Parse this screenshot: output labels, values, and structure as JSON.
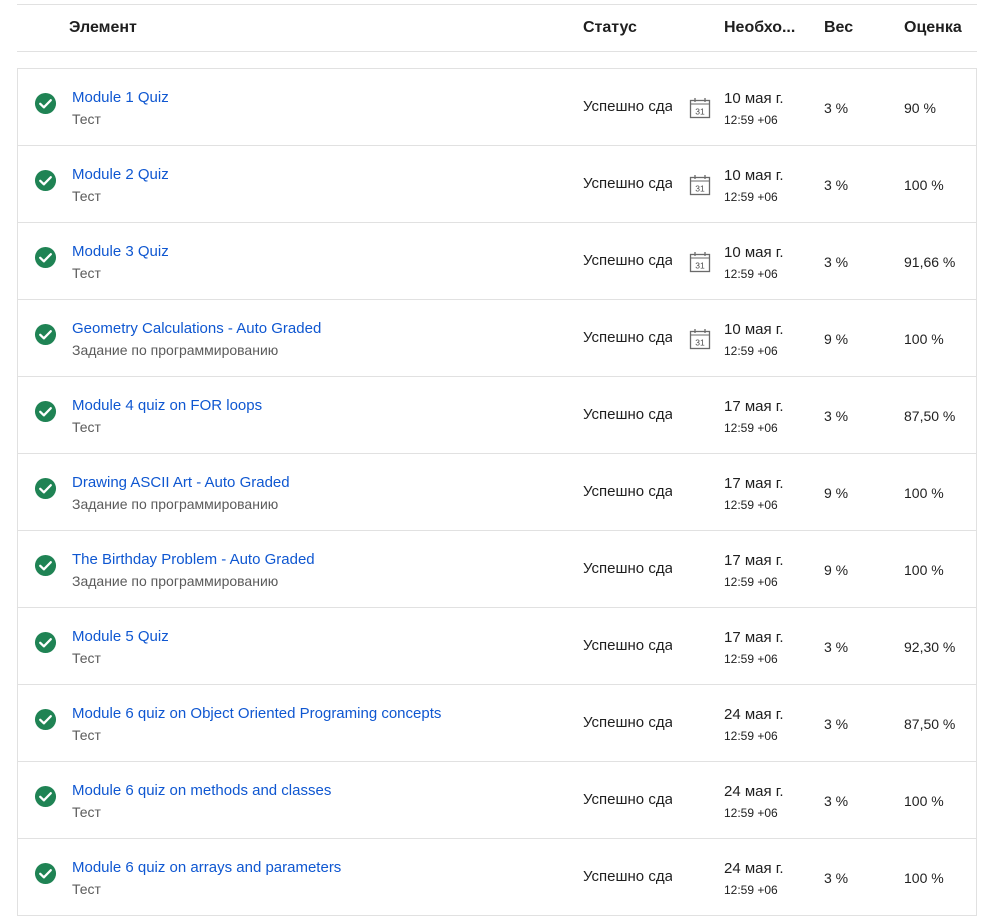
{
  "table": {
    "headers": {
      "item": "Элемент",
      "status": "Статус",
      "due": "Необхо...",
      "weight": "Вес",
      "grade": "Оценка"
    },
    "colors": {
      "link": "#0f57d1",
      "check": "#1f8354"
    },
    "rows": [
      {
        "title": "Module 1 Quiz",
        "type": "Тест",
        "status": "Успешно сдано",
        "calendar_icon": "calendar-31-icon",
        "due_date": "10 мая г.",
        "due_time": "12:59 +06",
        "weight": "3 %",
        "grade": "90 %"
      },
      {
        "title": "Module 2 Quiz",
        "type": "Тест",
        "status": "Успешно сдано",
        "calendar_icon": "calendar-31-icon",
        "due_date": "10 мая г.",
        "due_time": "12:59 +06",
        "weight": "3 %",
        "grade": "100 %"
      },
      {
        "title": "Module 3 Quiz",
        "type": "Тест",
        "status": "Успешно сдано",
        "calendar_icon": "calendar-31-icon",
        "due_date": "10 мая г.",
        "due_time": "12:59 +06",
        "weight": "3 %",
        "grade": "91,66 %"
      },
      {
        "title": "Geometry Calculations - Auto Graded",
        "type": "Задание по программированию",
        "status": "Успешно сдано",
        "calendar_icon": "calendar-31-icon",
        "due_date": "10 мая г.",
        "due_time": "12:59 +06",
        "weight": "9 %",
        "grade": "100 %"
      },
      {
        "title": "Module 4 quiz on FOR loops",
        "type": "Тест",
        "status": "Успешно сдано",
        "calendar_icon": "",
        "due_date": "17 мая г.",
        "due_time": "12:59 +06",
        "weight": "3 %",
        "grade": "87,50 %"
      },
      {
        "title": "Drawing ASCII Art - Auto Graded",
        "type": "Задание по программированию",
        "status": "Успешно сдано",
        "calendar_icon": "",
        "due_date": "17 мая г.",
        "due_time": "12:59 +06",
        "weight": "9 %",
        "grade": "100 %"
      },
      {
        "title": "The Birthday Problem - Auto Graded",
        "type": "Задание по программированию",
        "status": "Успешно сдано",
        "calendar_icon": "",
        "due_date": "17 мая г.",
        "due_time": "12:59 +06",
        "weight": "9 %",
        "grade": "100 %"
      },
      {
        "title": "Module 5 Quiz",
        "type": "Тест",
        "status": "Успешно сдано",
        "calendar_icon": "",
        "due_date": "17 мая г.",
        "due_time": "12:59 +06",
        "weight": "3 %",
        "grade": "92,30 %"
      },
      {
        "title": "Module 6 quiz on Object Oriented Programing concepts",
        "type": "Тест",
        "status": "Успешно сдано",
        "calendar_icon": "",
        "due_date": "24 мая г.",
        "due_time": "12:59 +06",
        "weight": "3 %",
        "grade": "87,50 %"
      },
      {
        "title": "Module 6 quiz on methods and classes",
        "type": "Тест",
        "status": "Успешно сдано",
        "calendar_icon": "",
        "due_date": "24 мая г.",
        "due_time": "12:59 +06",
        "weight": "3 %",
        "grade": "100 %"
      },
      {
        "title": "Module 6 quiz on arrays and parameters",
        "type": "Тест",
        "status": "Успешно сдано",
        "calendar_icon": "",
        "due_date": "24 мая г.",
        "due_time": "12:59 +06",
        "weight": "3 %",
        "grade": "100 %"
      }
    ]
  }
}
